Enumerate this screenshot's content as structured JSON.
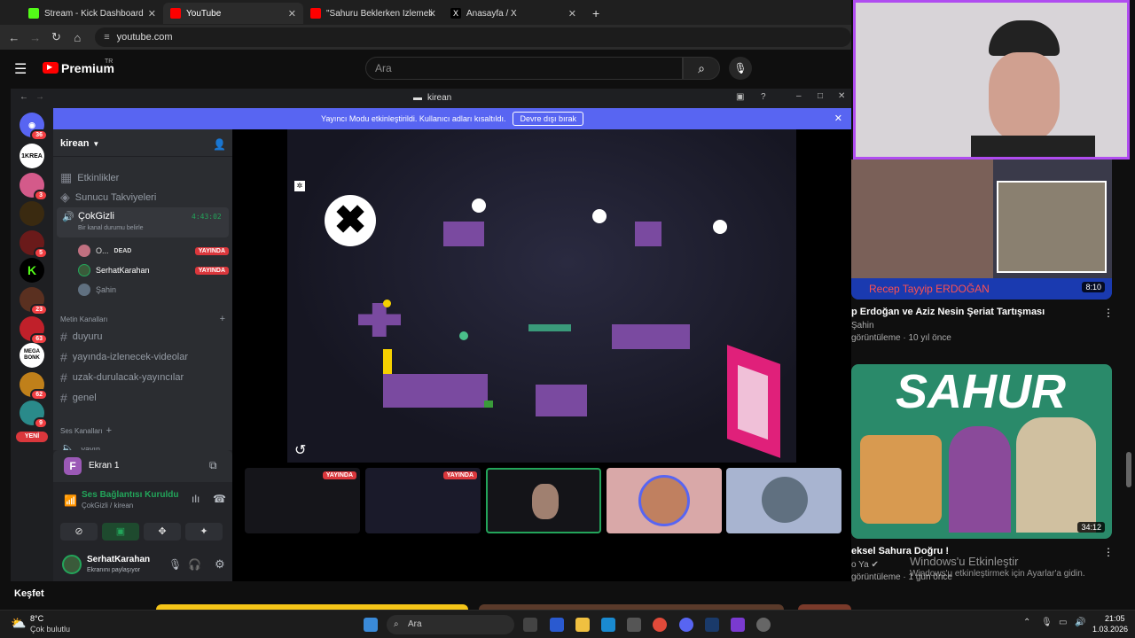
{
  "tabs": [
    {
      "label": "Stream - Kick Dashboard",
      "color": "#53fc18"
    },
    {
      "label": "YouTube",
      "color": "#ff0000"
    },
    {
      "label": "\"Sahuru Beklerken İzlemelik Ed",
      "color": "#ff0000"
    },
    {
      "label": "Anasayfa / X",
      "color": "#ffffff"
    }
  ],
  "address": {
    "url": "youtube.com"
  },
  "youtube": {
    "brand": "Premium",
    "region": "TR",
    "search_placeholder": "Ara",
    "explore": "Keşfet"
  },
  "discord": {
    "window_title": "kirean",
    "banner_text": "Yayıncı Modu etkinleştirildi. Kullanıcı adları kısaltıldı.",
    "banner_button": "Devre dışı bırak",
    "server_name": "kirean",
    "events": "Etkinlikler",
    "boosts": "Sunucu Takviyeleri",
    "voice_channel": {
      "name": "ÇokGizli",
      "timer": "4:43:02",
      "status": "Bir kanal durumu belirle"
    },
    "members": [
      {
        "name": "O...",
        "tag": "DEAD",
        "live": "YAYINDA"
      },
      {
        "name": "SerhatKarahan",
        "live": "YAYINDA"
      },
      {
        "name": "Şahin"
      }
    ],
    "text_category": "Metin Kanalları",
    "text_channels": [
      "duyuru",
      "yayında-izlenecek-videolar",
      "uzak-durulacak-yayıncılar",
      "genel"
    ],
    "voice_category": "Ses Kanalları",
    "voice_partial": "yayın",
    "screen_title": "Ekran 1",
    "connection_status": "Ses Bağlantısı Kuruldu",
    "connection_sub": "ÇokGizli / kirean",
    "user": {
      "name": "SerhatKarahan",
      "status": "Ekranını paylaşıyor"
    },
    "badges": [
      "36",
      "3",
      "5",
      "23",
      "63",
      "62",
      "9"
    ],
    "new_label": "YENİ",
    "guild_labels": [
      "1KREA",
      "K",
      "MEGA BONK"
    ],
    "thumb_live": "YAYINDA"
  },
  "right": {
    "video1": {
      "title": "p Erdoğan ve Aziz Nesin Şeriat Tartışması",
      "channel": "Şahin",
      "meta": "görüntüleme · 10 yıl önce",
      "duration": "8:10",
      "caption": "Recep Tayyip ERDOĞAN"
    },
    "video2": {
      "title": "eksel Sahura Doğru !",
      "channel": "o Ya",
      "meta": "görüntüleme · 1 gün önce",
      "duration": "34:12",
      "thumb_text": "SAHUR"
    },
    "activate": {
      "title": "Windows'u Etkinleştir",
      "sub": "Windows'u etkinleştirmek için Ayarlar'a gidin."
    }
  },
  "taskbar": {
    "weather_temp": "8°C",
    "weather_desc": "Çok bulutlu",
    "search": "Ara",
    "time": "21:05",
    "date": "1.03.2026"
  }
}
